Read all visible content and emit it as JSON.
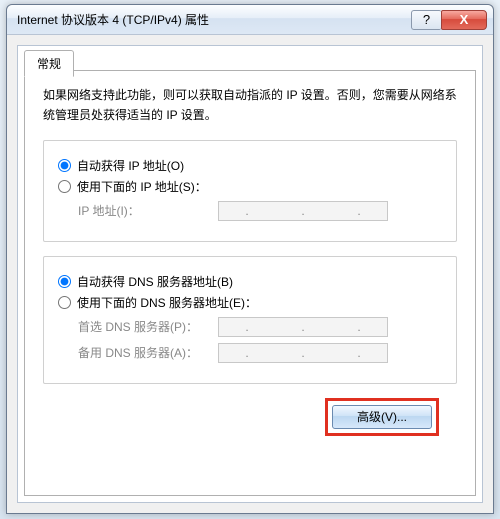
{
  "window": {
    "title": "Internet 协议版本 4 (TCP/IPv4) 属性",
    "help_glyph": "?",
    "close_glyph": "X"
  },
  "tab": {
    "general_label": "常规"
  },
  "description": "如果网络支持此功能，则可以获取自动指派的 IP 设置。否则，您需要从网络系统管理员处获得适当的 IP 设置。",
  "ip_group": {
    "auto_label": "自动获得 IP 地址(O)",
    "manual_label": "使用下面的 IP 地址(S)：",
    "ip_label": "IP 地址(I)：",
    "ip_value": "",
    "auto_selected": true
  },
  "dns_group": {
    "auto_label": "自动获得 DNS 服务器地址(B)",
    "manual_label": "使用下面的 DNS 服务器地址(E)：",
    "preferred_label": "首选 DNS 服务器(P)：",
    "preferred_value": "",
    "alternate_label": "备用 DNS 服务器(A)：",
    "alternate_value": "",
    "auto_selected": true
  },
  "buttons": {
    "advanced_label": "高级(V)..."
  }
}
